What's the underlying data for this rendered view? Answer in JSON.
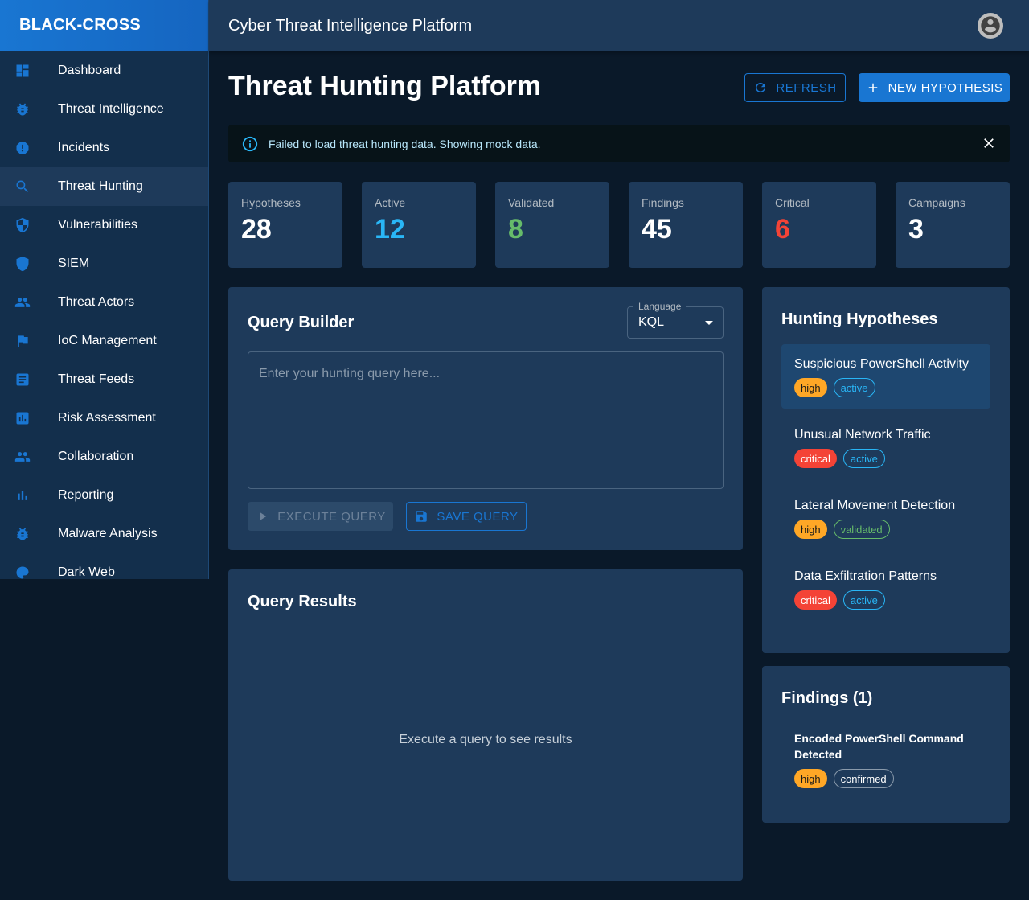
{
  "brand": "BLACK-CROSS",
  "topbar": {
    "title": "Cyber Threat Intelligence Platform"
  },
  "sidebar": {
    "items": [
      {
        "label": "Dashboard",
        "icon": "dashboard-icon"
      },
      {
        "label": "Threat Intelligence",
        "icon": "bug-icon"
      },
      {
        "label": "Incidents",
        "icon": "report-icon"
      },
      {
        "label": "Threat Hunting",
        "icon": "search-icon",
        "active": true
      },
      {
        "label": "Vulnerabilities",
        "icon": "shield-half-icon"
      },
      {
        "label": "SIEM",
        "icon": "shield-icon"
      },
      {
        "label": "Threat Actors",
        "icon": "people-icon"
      },
      {
        "label": "IoC Management",
        "icon": "flag-icon"
      },
      {
        "label": "Threat Feeds",
        "icon": "document-icon"
      },
      {
        "label": "Risk Assessment",
        "icon": "assessment-icon"
      },
      {
        "label": "Collaboration",
        "icon": "people-icon"
      },
      {
        "label": "Reporting",
        "icon": "bar-chart-icon"
      },
      {
        "label": "Malware Analysis",
        "icon": "bug-icon"
      },
      {
        "label": "Dark Web",
        "icon": "moon-icon"
      }
    ]
  },
  "page": {
    "title": "Threat Hunting Platform",
    "refresh_label": "REFRESH",
    "new_hypothesis_label": "NEW HYPOTHESIS"
  },
  "alert": {
    "message": "Failed to load threat hunting data. Showing mock data."
  },
  "stats": [
    {
      "label": "Hypotheses",
      "value": "28",
      "color": "#ffffff"
    },
    {
      "label": "Active",
      "value": "12",
      "color": "#29b6f6"
    },
    {
      "label": "Validated",
      "value": "8",
      "color": "#66bb6a"
    },
    {
      "label": "Findings",
      "value": "45",
      "color": "#ffffff"
    },
    {
      "label": "Critical",
      "value": "6",
      "color": "#f44336"
    },
    {
      "label": "Campaigns",
      "value": "3",
      "color": "#ffffff"
    }
  ],
  "query_builder": {
    "title": "Query Builder",
    "language_label": "Language",
    "language_value": "KQL",
    "placeholder": "Enter your hunting query here...",
    "execute_label": "EXECUTE QUERY",
    "save_label": "SAVE QUERY"
  },
  "query_results": {
    "title": "Query Results",
    "empty_text": "Execute a query to see results"
  },
  "hypotheses": {
    "title": "Hunting Hypotheses",
    "items": [
      {
        "name": "Suspicious PowerShell Activity",
        "priority": "high",
        "status": "active"
      },
      {
        "name": "Unusual Network Traffic",
        "priority": "critical",
        "status": "active"
      },
      {
        "name": "Lateral Movement Detection",
        "priority": "high",
        "status": "validated"
      },
      {
        "name": "Data Exfiltration Patterns",
        "priority": "critical",
        "status": "active"
      }
    ]
  },
  "findings": {
    "title": "Findings (1)",
    "items": [
      {
        "title": "Encoded PowerShell Command Detected",
        "severity": "high",
        "status": "confirmed"
      }
    ]
  },
  "colors": {
    "accent": "#1976d2",
    "background": "#0a1929",
    "card": "#1e3a5a",
    "sidebar": "#132f4c"
  }
}
